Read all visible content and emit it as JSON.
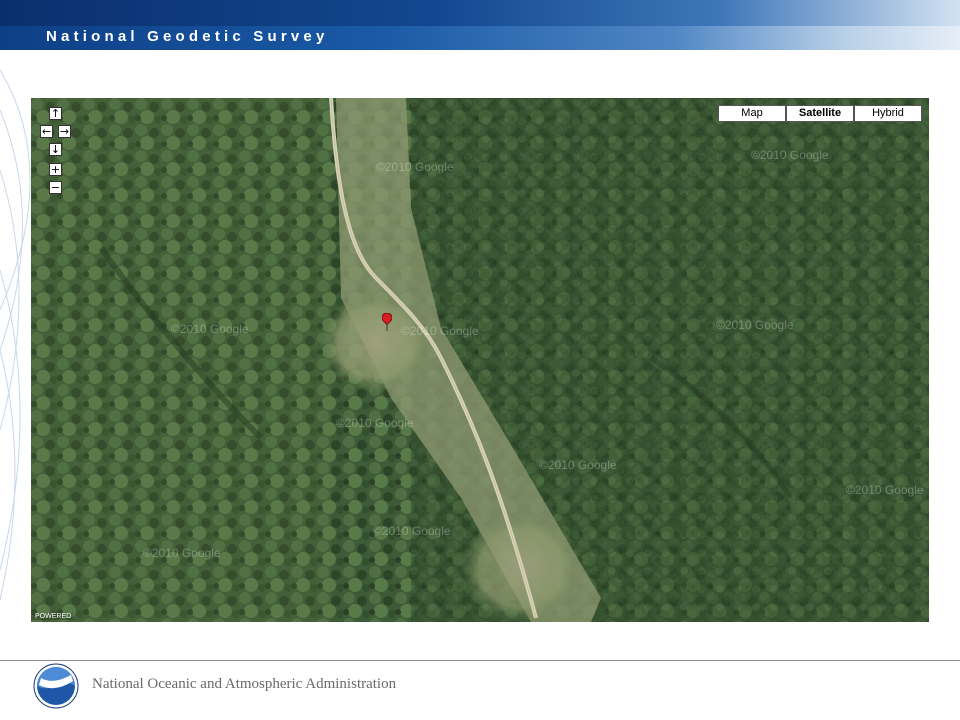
{
  "header": {
    "title": "National Geodetic Survey"
  },
  "map": {
    "type_buttons": [
      {
        "label": "Map",
        "active": false
      },
      {
        "label": "Satellite",
        "active": true
      },
      {
        "label": "Hybrid",
        "active": false
      }
    ],
    "watermark_text": "©2010 Google",
    "powered_label": "POWERED",
    "nav_icons": [
      "pan-up-icon",
      "pan-left-icon",
      "pan-right-icon",
      "pan-down-icon",
      "zoom-in-icon",
      "zoom-out-icon"
    ],
    "marker_color": "#d42020"
  },
  "footer": {
    "agency": "National Oceanic and Atmospheric Administration",
    "logo_text": "NOAA"
  },
  "colors": {
    "header_blue": "#12478f",
    "forest_dark": "#2f4a2a",
    "forest_light": "#6f8a4f",
    "road": "#cfc9ad"
  }
}
